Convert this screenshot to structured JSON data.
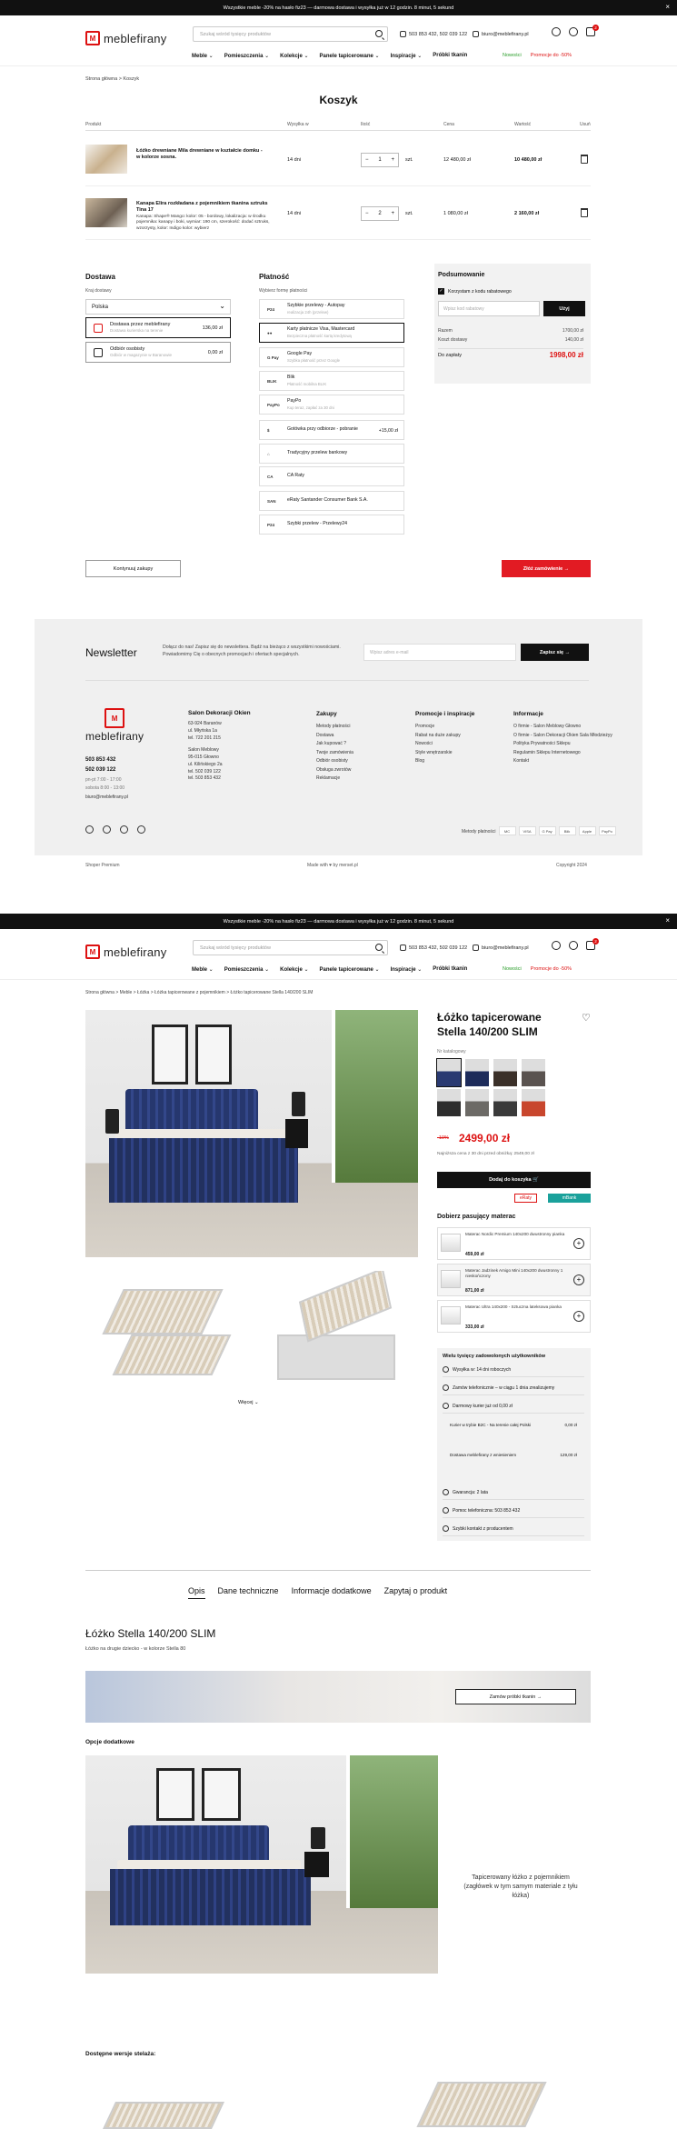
{
  "cart_page": {
    "topbar": "Wszystkie meble -20% na hasło fiz23 — darmowa dostawa i wysyłka już w 12 godzin. 8 minut, 5 sekund",
    "search_placeholder": "Szukaj wśród tysięcy produktów",
    "phone": "503 853 432, 502 039 122",
    "email": "biuro@meblefirany.pl",
    "logo": "meblefirany",
    "nav": [
      "Meble",
      "Pomieszczenia",
      "Kolekcje",
      "Panele tapicerowane",
      "Inspiracje",
      "Próbki tkanin"
    ],
    "nav_right": [
      "Nowości",
      "Promocje do -50%"
    ],
    "breadcrumb": "Strona główna  >  Koszyk",
    "title": "Koszyk",
    "columns": [
      "Produkt",
      "Wysyłka w",
      "Ilość",
      "Cena",
      "Wartość",
      "Usuń"
    ],
    "items": [
      {
        "name": "Łóżko drewniane Mila drewniane w kształcie domku - w kolorze sosna.",
        "days": "14 dni",
        "qty": "1",
        "unit": "szt.",
        "price": "12 480,00 zł",
        "value": "10 480,00 zł"
      },
      {
        "name": "Kanapa Elira rozkładana z pojemnikiem tkanina sztruks Tina 17",
        "desc": "Kanapa: Shape® Mango: kolor: 05 - bordowy, lokalizacja: w środku pojemnika: kanapy i boki, wymiar: 190 cm, szerokość: dodać sztruks, wzorzysty, kolor: Indigo kolor: wybierz",
        "days": "14 dni",
        "qty": "2",
        "unit": "szt.",
        "price": "1 080,00 zł",
        "value": "2 160,00 zł"
      }
    ],
    "delivery": {
      "title": "Dostawa",
      "country_label": "Kraj dostawy",
      "country": "Polska",
      "options": [
        {
          "name": "Dostawa przez meblefirany",
          "sub": "Dostawa kurierska na terenie",
          "price": "136,00 zł"
        },
        {
          "name": "Odbiór osobisty",
          "sub": "Odbiór w magazynie w Baranowie",
          "price": "0,00 zł"
        }
      ]
    },
    "payment": {
      "title": "Płatność",
      "label": "Wybierz formę płatności",
      "options": [
        {
          "logo": "P24",
          "name": "Szybkie przelewy - Autopay",
          "sub": "realizacja 24h (przelew)",
          "price": ""
        },
        {
          "logo": "●●",
          "name": "Karty płatnicze Visa, Mastercard",
          "sub": "Bezpieczna płatność kartą kredytową",
          "price": ""
        },
        {
          "logo": "G Pay",
          "name": "Google Pay",
          "sub": "Szybka płatność przez Google",
          "price": ""
        },
        {
          "logo": "BLIK",
          "name": "Blik",
          "sub": "Płatność mobilna BLIK",
          "price": ""
        },
        {
          "logo": "PayPo",
          "name": "PayPo",
          "sub": "Kup teraz, zapłać za 30 dni",
          "price": ""
        },
        {
          "logo": "$",
          "name": "Gotówka przy odbiorze - pobranie",
          "sub": "",
          "price": "+15,00 zł"
        },
        {
          "logo": "⌂",
          "name": "Tradycyjny przelew bankowy",
          "sub": "",
          "price": ""
        },
        {
          "logo": "CA",
          "name": "CA Raty",
          "sub": "",
          "price": ""
        },
        {
          "logo": "SAN",
          "name": "eRaty Santander Consumer Bank S.A.",
          "sub": "",
          "price": ""
        },
        {
          "logo": "P24",
          "name": "Szybki przelew - Przelewy24",
          "sub": "",
          "price": ""
        }
      ]
    },
    "summary": {
      "title": "Podsumowanie",
      "code_label": "Korzystam z kodu rabatowego",
      "code_placeholder": "Wpisz kod rabatowy",
      "apply": "Użyj",
      "rows": [
        [
          "Razem",
          "1700,00 zł"
        ],
        [
          "Koszt dostawy",
          "140,00 zł"
        ]
      ],
      "total_label": "Do zapłaty",
      "total": "1998,00 zł"
    },
    "continue": "Kontynuuj zakupy",
    "order": "Złóż zamówienie  →",
    "newsletter": {
      "title": "Newsletter",
      "text": "Dołącz do nas! Zapisz się do newslettera. Bądź na bieżąco z wszystkimi nowościami. Powiadomimy Cię o obecnych promocjach i ofertach specjalnych.",
      "placeholder": "Wpisz adres e-mail",
      "button": "Zapisz się  →"
    },
    "footer": {
      "phones": "503 853 432\n502 039 122",
      "hours": "pn-pt 7:00 - 17:00\nsobota 8:00 - 13:00",
      "email": "biuro@meblefirany.pl",
      "col1_title": "Salon Dekoracji Okien",
      "col1": [
        "63-924 Baranów",
        "ul. Młyńska 1a",
        "tel. 722 201 215",
        "",
        "Salon Meblowy",
        "95-015 Głowno",
        "ul. Kilińskiego 2a",
        "tel. 502 039 122",
        "tel. 503 853 432"
      ],
      "col2_title": "Zakupy",
      "col2": [
        "Metody płatności",
        "Dostawa",
        "Jak kupować ?",
        "Twoje zamówienia",
        "Odbiór osobisty",
        "Obsługa zwrotów",
        "Reklamacje"
      ],
      "col3_title": "Promocje i inspiracje",
      "col3": [
        "Promocje",
        "Rabat na duże zakupy",
        "Nowości",
        "Style wnętrzarskie",
        "Blog"
      ],
      "col4_title": "Informacje",
      "col4": [
        "O firmie - Salon Meblowy Głowno",
        "O firmie - Salon Dekoracji Okien Sala Młodzieżyy",
        "Polityka Prywatności Sklepu",
        "Regulamin Sklepu Internetowego",
        "Kontakt"
      ],
      "payments_label": "Metody płatności",
      "payments": [
        "MC",
        "VISA",
        "G Pay",
        "Blik",
        "Apple",
        "PayPo"
      ],
      "bottom": [
        "Shoper Premium",
        "Made with ♥ by merset.pl",
        "Copyright 2024"
      ]
    }
  },
  "product_page": {
    "topbar": "Wszystkie meble -20% na hasło fiz23 — darmowa dostawa i wysyłka już w 12 godzin. 8 minut, 5 sekund",
    "breadcrumb": "Strona główna  >  Meble  >  Łóżka  >  Łóżka tapicerowane z pojemnikiem  >  Łóżko tapicerowane Stella 140/200 SLIM",
    "nav": [
      "Meble",
      "Pomieszczenia",
      "Kolekcje",
      "Panele tapicerowane",
      "Inspiracje",
      "Próbki tkanin"
    ],
    "title": "Łóżko tapicerowane Stella 140/200 SLIM",
    "sku": "Nr katalogowy",
    "old_price": "-10%",
    "price": "2499,00 zł",
    "price_note": "Najniższa cena z 30 dni przed obniżką: 2549,00 zł",
    "add_to_cart": "Dodaj do koszyka  🛒",
    "installments": [
      "mBank",
      "eRaty"
    ],
    "mattress_title": "Dobierz pasujący materac",
    "mattresses": [
      {
        "name": "Materac Nordic Premium 140x200 dwustronny pianka",
        "price": "459,00 zł"
      },
      {
        "name": "Materac Jadzinek Amigo Mini 140x200 dwustronny 1 nieskończony",
        "price": "871,00 zł"
      },
      {
        "name": "Materac Ultra 140x200 - Sztuczna lateksowa pianka",
        "price": "333,00 zł"
      }
    ],
    "info_title": "Wielu tysięcy zadowolonych użytkowników",
    "info_rows": [
      "Wysyłka w: 14 dni roboczych",
      "Zamów telefonicznie – w ciągu 1 dnia zrealizujemy",
      "Darmowy kurier już od 0,00 zł",
      "Gwarancja: 2 lata",
      "Pomoc telefoniczna: 503 853 432",
      "Szybki kontakt z producentem"
    ],
    "ship_items": [
      [
        "Kurier w trybie B2C - Na terenie całej Polski",
        "0,00 zł"
      ],
      [
        "Dostawa meblefirany z wniesieniem",
        "129,00 zł"
      ]
    ],
    "tabs": [
      "Opis",
      "Dane techniczne",
      "Informacje dodatkowe",
      "Zapytaj o produkt"
    ],
    "desc_title": "Łóżko Stella 140/200 SLIM",
    "desc_sub": "Łóżko na drugie dziecko - w kolorze Stella 80",
    "fabric_btn": "Zamów próbki tkanin  →",
    "extra_title": "Opcje dodatkowe",
    "extra_text": "Tapicerowany łóżko z pojemnikiem (zagłówek w tym samym materiale z tyłu łóżka)",
    "versions_title": "Dostępne wersje stelaża:",
    "gallery_more": "Więcej ⌄"
  }
}
